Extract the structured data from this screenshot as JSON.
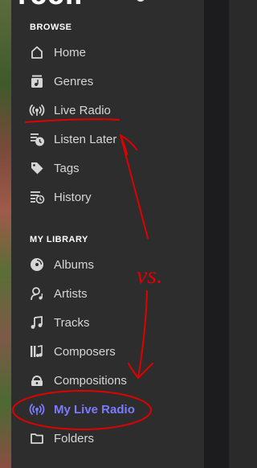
{
  "app": {
    "logo_text": "roon"
  },
  "browse": {
    "header": "BROWSE",
    "items": [
      {
        "label": "Home",
        "icon": "home-icon"
      },
      {
        "label": "Genres",
        "icon": "genres-icon"
      },
      {
        "label": "Live Radio",
        "icon": "radio-icon"
      },
      {
        "label": "Listen Later",
        "icon": "listen-later-icon"
      },
      {
        "label": "Tags",
        "icon": "tag-icon"
      },
      {
        "label": "History",
        "icon": "history-icon"
      }
    ]
  },
  "library": {
    "header": "MY LIBRARY",
    "items": [
      {
        "label": "Albums",
        "icon": "album-icon"
      },
      {
        "label": "Artists",
        "icon": "artist-icon"
      },
      {
        "label": "Tracks",
        "icon": "music-note-icon"
      },
      {
        "label": "Composers",
        "icon": "composers-icon"
      },
      {
        "label": "Compositions",
        "icon": "compositions-icon"
      },
      {
        "label": "My Live Radio",
        "icon": "radio-icon",
        "active": true
      },
      {
        "label": "Folders",
        "icon": "folder-icon"
      }
    ]
  },
  "annotation": {
    "text": "vs."
  },
  "colors": {
    "active": "#7b7bff",
    "annotation": "#e00000",
    "sidebar_bg": "#2d2d2e"
  }
}
